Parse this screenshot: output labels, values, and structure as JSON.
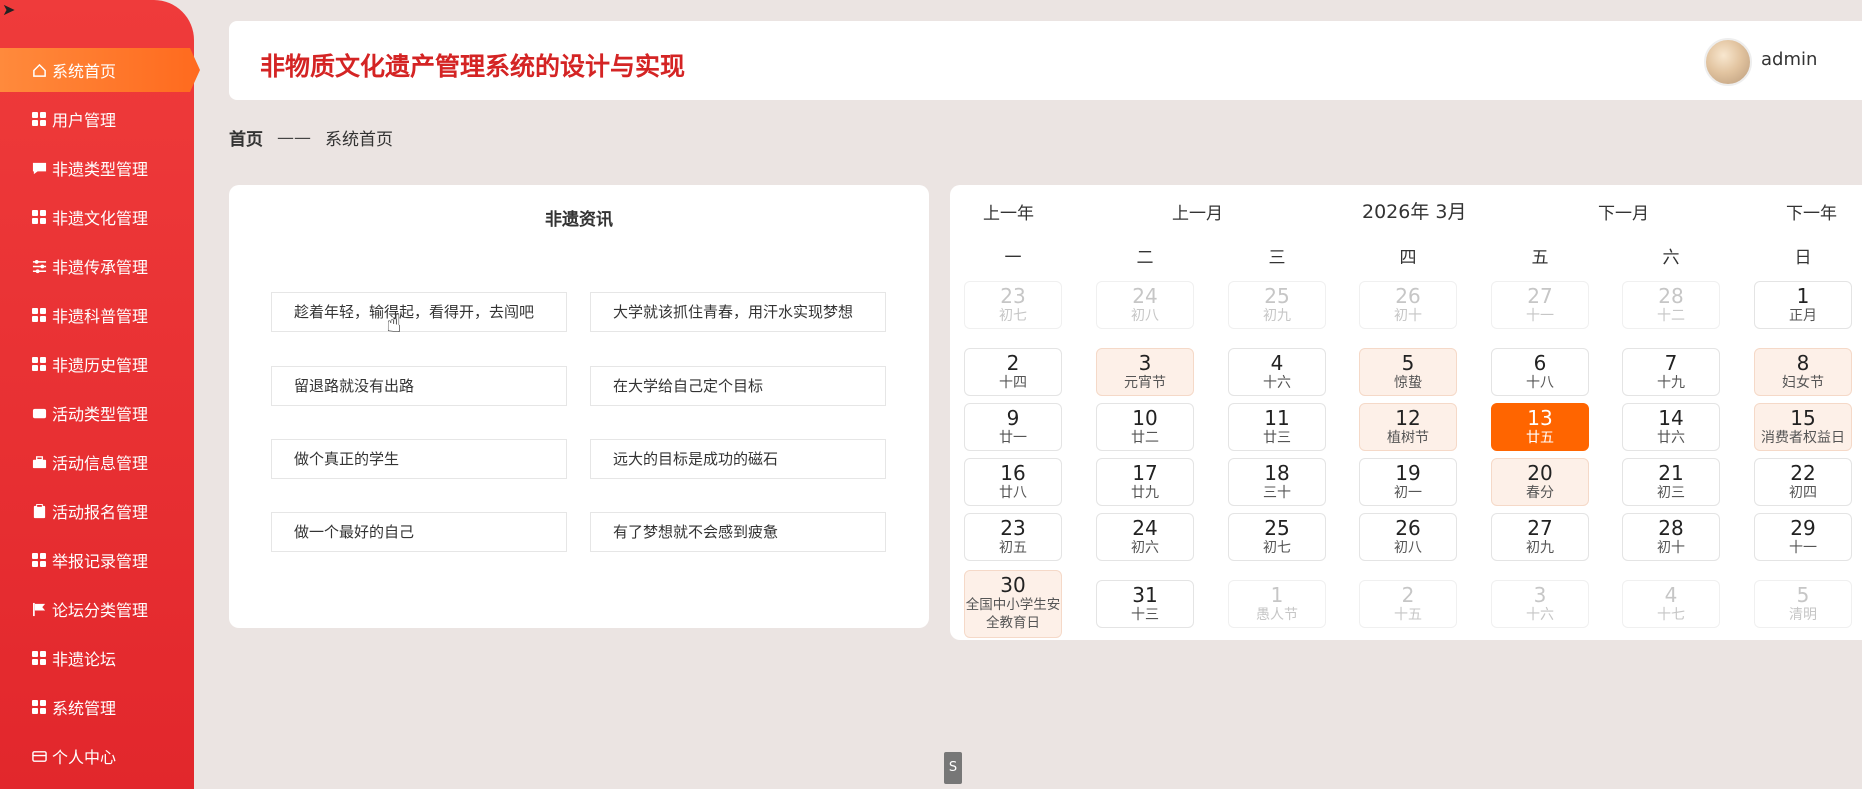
{
  "app": {
    "title": "非物质文化遗产管理系统的设计与实现",
    "username": "admin"
  },
  "colors": {
    "sidebar": "#e2272c",
    "active_menu": "#ff6a1e",
    "title": "#d42424",
    "today": "#ff6500",
    "festival_bg": "#fdf0e8"
  },
  "sidebar": {
    "items": [
      {
        "label": "系统首页",
        "icon": "home-icon",
        "active": true
      },
      {
        "label": "用户管理",
        "icon": "grid-icon"
      },
      {
        "label": "非遗类型管理",
        "icon": "chat-icon"
      },
      {
        "label": "非遗文化管理",
        "icon": "grid-icon"
      },
      {
        "label": "非遗传承管理",
        "icon": "sliders-icon"
      },
      {
        "label": "非遗科普管理",
        "icon": "grid-icon"
      },
      {
        "label": "非遗历史管理",
        "icon": "grid-icon"
      },
      {
        "label": "活动类型管理",
        "icon": "ticket-icon"
      },
      {
        "label": "活动信息管理",
        "icon": "briefcase-icon"
      },
      {
        "label": "活动报名管理",
        "icon": "clipboard-icon"
      },
      {
        "label": "举报记录管理",
        "icon": "grid-icon"
      },
      {
        "label": "论坛分类管理",
        "icon": "flag-icon"
      },
      {
        "label": "非遗论坛",
        "icon": "grid-icon"
      },
      {
        "label": "系统管理",
        "icon": "grid-icon"
      },
      {
        "label": "个人中心",
        "icon": "card-icon"
      }
    ]
  },
  "breadcrumb": {
    "root": "首页",
    "separator": "——",
    "current": "系统首页"
  },
  "news": {
    "title": "非遗资讯",
    "items": [
      "趁着年轻，输得起，看得开，去闯吧",
      "大学就该抓住青春，用汗水实现梦想",
      "留退路就没有出路",
      "在大学给自己定个目标",
      "做个真正的学生",
      "远大的目标是成功的磁石",
      "做一个最好的自己",
      "有了梦想就不会感到疲惫"
    ]
  },
  "calendar": {
    "prev_year": "上一年",
    "prev_month": "上一月",
    "month_label": "2026年 3月",
    "next_month": "下一月",
    "next_year": "下一年",
    "weekdays": [
      "一",
      "二",
      "三",
      "四",
      "五",
      "六",
      "日"
    ],
    "weeks": [
      [
        {
          "d": "23",
          "l": "初七",
          "t": "other"
        },
        {
          "d": "24",
          "l": "初八",
          "t": "other"
        },
        {
          "d": "25",
          "l": "初九",
          "t": "other"
        },
        {
          "d": "26",
          "l": "初十",
          "t": "other"
        },
        {
          "d": "27",
          "l": "十一",
          "t": "other"
        },
        {
          "d": "28",
          "l": "十二",
          "t": "other"
        },
        {
          "d": "1",
          "l": "正月",
          "t": ""
        }
      ],
      [
        {
          "d": "2",
          "l": "十四",
          "t": ""
        },
        {
          "d": "3",
          "l": "元宵节",
          "t": "fest"
        },
        {
          "d": "4",
          "l": "十六",
          "t": ""
        },
        {
          "d": "5",
          "l": "惊蛰",
          "t": "fest"
        },
        {
          "d": "6",
          "l": "十八",
          "t": ""
        },
        {
          "d": "7",
          "l": "十九",
          "t": ""
        },
        {
          "d": "8",
          "l": "妇女节",
          "t": "fest"
        }
      ],
      [
        {
          "d": "9",
          "l": "廿一",
          "t": ""
        },
        {
          "d": "10",
          "l": "廿二",
          "t": ""
        },
        {
          "d": "11",
          "l": "廿三",
          "t": ""
        },
        {
          "d": "12",
          "l": "植树节",
          "t": "fest"
        },
        {
          "d": "13",
          "l": "廿五",
          "t": "today"
        },
        {
          "d": "14",
          "l": "廿六",
          "t": ""
        },
        {
          "d": "15",
          "l": "消费者权益日",
          "t": "fest"
        }
      ],
      [
        {
          "d": "16",
          "l": "廿八",
          "t": ""
        },
        {
          "d": "17",
          "l": "廿九",
          "t": ""
        },
        {
          "d": "18",
          "l": "三十",
          "t": ""
        },
        {
          "d": "19",
          "l": "初一",
          "t": ""
        },
        {
          "d": "20",
          "l": "春分",
          "t": "fest"
        },
        {
          "d": "21",
          "l": "初三",
          "t": ""
        },
        {
          "d": "22",
          "l": "初四",
          "t": ""
        }
      ],
      [
        {
          "d": "23",
          "l": "初五",
          "t": ""
        },
        {
          "d": "24",
          "l": "初六",
          "t": ""
        },
        {
          "d": "25",
          "l": "初七",
          "t": ""
        },
        {
          "d": "26",
          "l": "初八",
          "t": ""
        },
        {
          "d": "27",
          "l": "初九",
          "t": ""
        },
        {
          "d": "28",
          "l": "初十",
          "t": ""
        },
        {
          "d": "29",
          "l": "十一",
          "t": ""
        }
      ],
      [
        {
          "d": "30",
          "l": "全国中小学生安全教育日",
          "t": "fest tall"
        },
        {
          "d": "31",
          "l": "十三",
          "t": ""
        },
        {
          "d": "1",
          "l": "愚人节",
          "t": "other"
        },
        {
          "d": "2",
          "l": "十五",
          "t": "other"
        },
        {
          "d": "3",
          "l": "十六",
          "t": "other"
        },
        {
          "d": "4",
          "l": "十七",
          "t": "other"
        },
        {
          "d": "5",
          "l": "清明",
          "t": "other"
        }
      ]
    ]
  },
  "overlay": {
    "badge": "S"
  }
}
